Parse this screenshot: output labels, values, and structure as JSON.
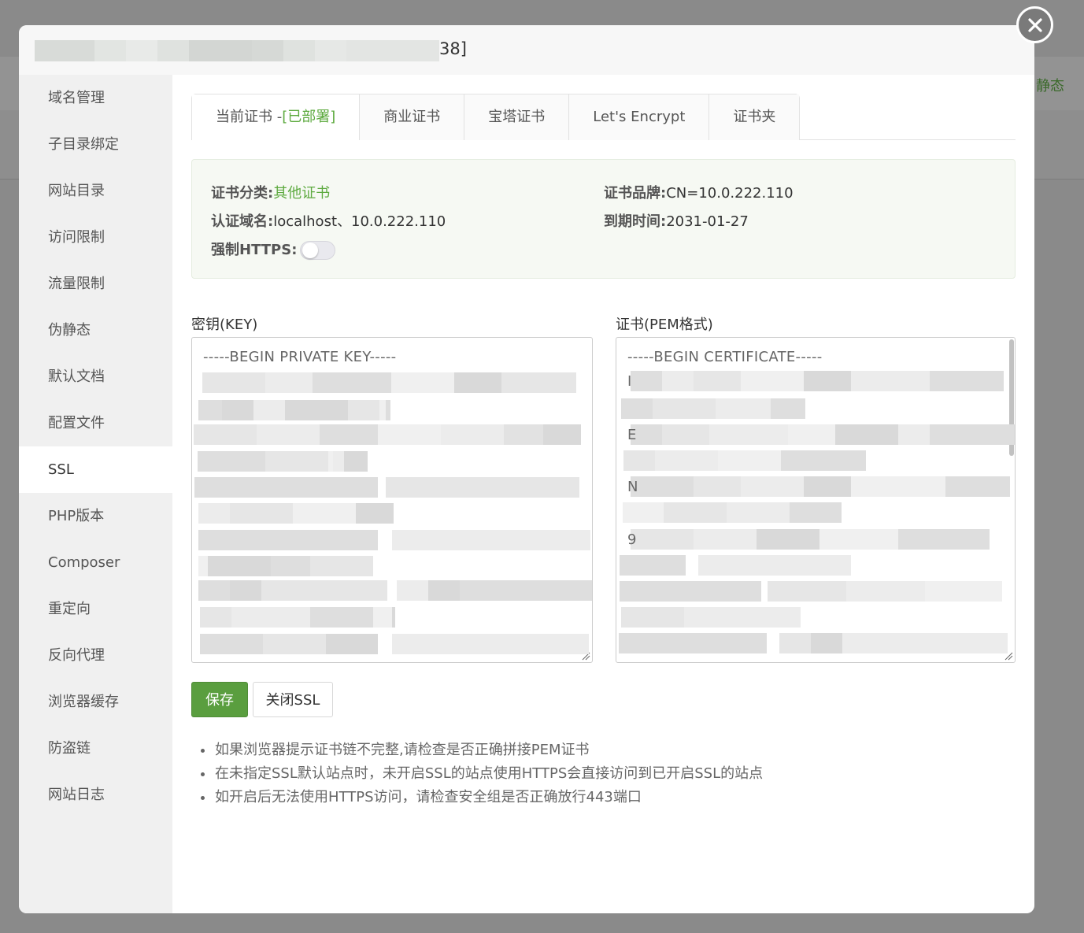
{
  "background": {
    "right_text": "静态"
  },
  "header": {
    "title_suffix": "38]"
  },
  "sidebar": {
    "items": [
      {
        "label": "域名管理"
      },
      {
        "label": "子目录绑定"
      },
      {
        "label": "网站目录"
      },
      {
        "label": "访问限制"
      },
      {
        "label": "流量限制"
      },
      {
        "label": "伪静态"
      },
      {
        "label": "默认文档"
      },
      {
        "label": "配置文件"
      },
      {
        "label": "SSL",
        "active": true
      },
      {
        "label": "PHP版本"
      },
      {
        "label": "Composer"
      },
      {
        "label": "重定向"
      },
      {
        "label": "反向代理"
      },
      {
        "label": "浏览器缓存"
      },
      {
        "label": "防盗链"
      },
      {
        "label": "网站日志"
      }
    ]
  },
  "tabs": {
    "current_prefix": "当前证书 -",
    "current_status": "[已部署]",
    "commercial": "商业证书",
    "baota": "宝塔证书",
    "letsencrypt": "Let's Encrypt",
    "folder": "证书夹"
  },
  "cert_info": {
    "category_label": "证书分类:",
    "category_value": "其他证书",
    "brand_label": "证书品牌:",
    "brand_value": "CN=10.0.222.110",
    "domain_label": "认证域名:",
    "domain_value": "localhost、10.0.222.110",
    "expire_label": "到期时间:",
    "expire_value": "2031-01-27",
    "force_https_label": "强制HTTPS:",
    "force_https_enabled": false
  },
  "key_field": {
    "label": "密钥(KEY)",
    "first_line": "-----BEGIN PRIVATE KEY-----"
  },
  "cert_field": {
    "label": "证书(PEM格式)",
    "first_line": "-----BEGIN CERTIFICATE-----",
    "visible_lead_chars": [
      "I",
      "E",
      "N",
      "9"
    ]
  },
  "buttons": {
    "save": "保存",
    "close_ssl": "关闭SSL"
  },
  "tips": [
    "如果浏览器提示证书链不完整,请检查是否正确拼接PEM证书",
    "在未指定SSL默认站点时，未开启SSL的站点使用HTTPS会直接访问到已开启SSL的站点",
    "如开启后无法使用HTTPS访问，请检查安全组是否正确放行443端口"
  ],
  "colors": {
    "accent_green": "#5daa3f",
    "save_button": "#5a9e3f"
  }
}
